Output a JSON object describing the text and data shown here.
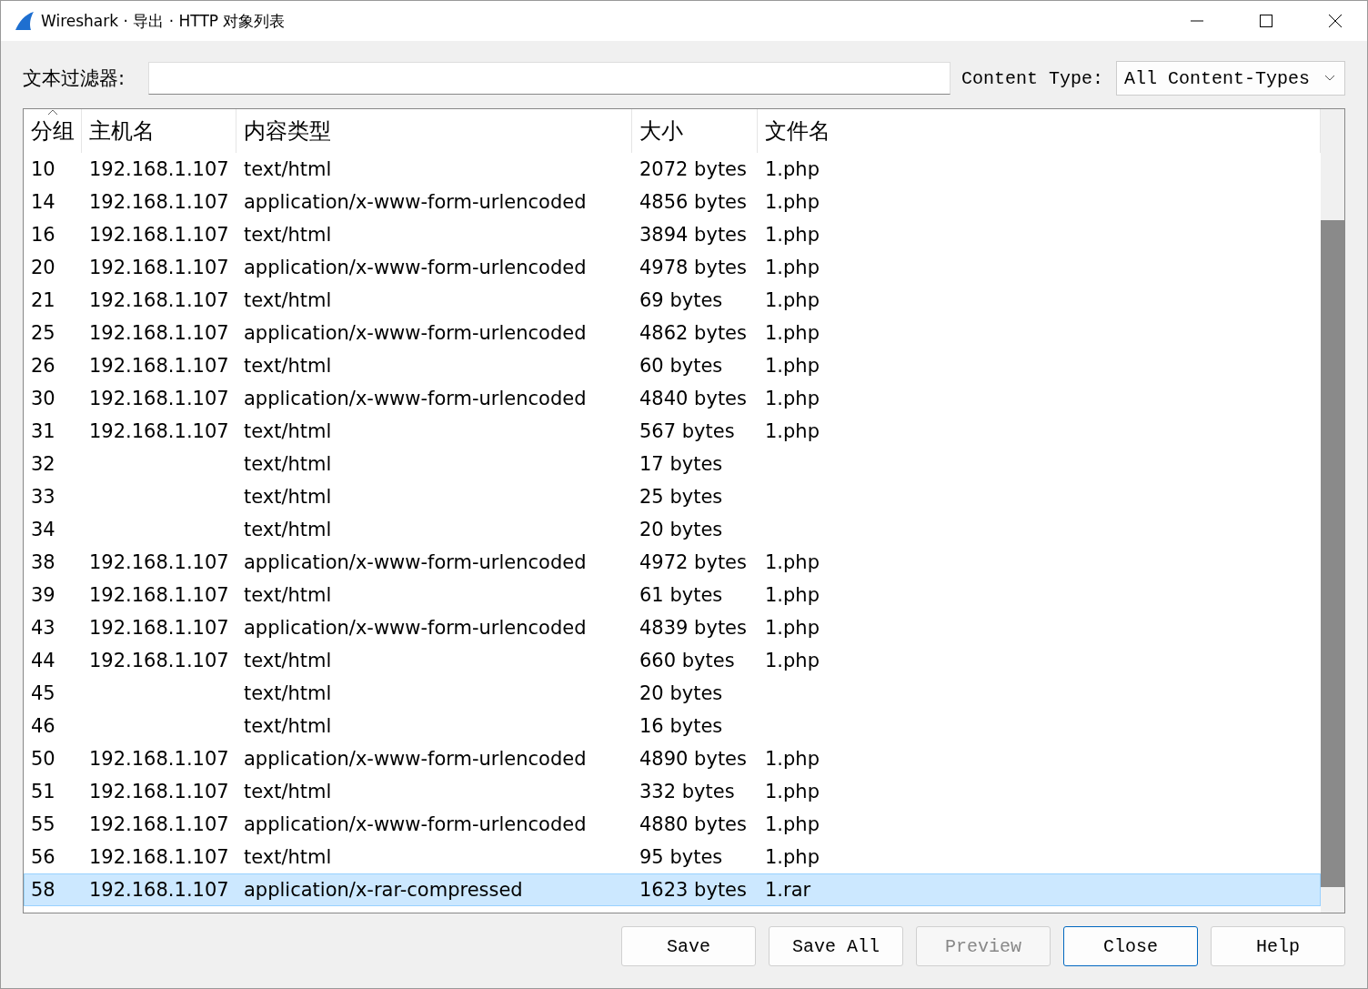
{
  "window": {
    "title": "Wireshark · 导出 · HTTP 对象列表"
  },
  "filter": {
    "label": "文本过滤器:"
  },
  "content_type": {
    "label": "Content Type:",
    "value": "All Content-Types"
  },
  "table": {
    "columns": [
      {
        "label": "分组",
        "sorted": true
      },
      {
        "label": "主机名",
        "sorted": false
      },
      {
        "label": "内容类型",
        "sorted": false
      },
      {
        "label": "大小",
        "sorted": false
      },
      {
        "label": "文件名",
        "sorted": false
      }
    ],
    "rows": [
      {
        "packet": "10",
        "host": "192.168.1.107",
        "type": "text/html",
        "size": "2072 bytes",
        "file": "1.php",
        "selected": false
      },
      {
        "packet": "14",
        "host": "192.168.1.107",
        "type": "application/x-www-form-urlencoded",
        "size": "4856 bytes",
        "file": "1.php",
        "selected": false
      },
      {
        "packet": "16",
        "host": "192.168.1.107",
        "type": "text/html",
        "size": "3894 bytes",
        "file": "1.php",
        "selected": false
      },
      {
        "packet": "20",
        "host": "192.168.1.107",
        "type": "application/x-www-form-urlencoded",
        "size": "4978 bytes",
        "file": "1.php",
        "selected": false
      },
      {
        "packet": "21",
        "host": "192.168.1.107",
        "type": "text/html",
        "size": "69 bytes",
        "file": "1.php",
        "selected": false
      },
      {
        "packet": "25",
        "host": "192.168.1.107",
        "type": "application/x-www-form-urlencoded",
        "size": "4862 bytes",
        "file": "1.php",
        "selected": false
      },
      {
        "packet": "26",
        "host": "192.168.1.107",
        "type": "text/html",
        "size": "60 bytes",
        "file": "1.php",
        "selected": false
      },
      {
        "packet": "30",
        "host": "192.168.1.107",
        "type": "application/x-www-form-urlencoded",
        "size": "4840 bytes",
        "file": "1.php",
        "selected": false
      },
      {
        "packet": "31",
        "host": "192.168.1.107",
        "type": "text/html",
        "size": "567 bytes",
        "file": "1.php",
        "selected": false
      },
      {
        "packet": "32",
        "type": "text/html",
        "size": "17 bytes",
        "selected": false
      },
      {
        "packet": "33",
        "type": "text/html",
        "size": "25 bytes",
        "selected": false
      },
      {
        "packet": "34",
        "type": "text/html",
        "size": "20 bytes",
        "selected": false
      },
      {
        "packet": "38",
        "host": "192.168.1.107",
        "type": "application/x-www-form-urlencoded",
        "size": "4972 bytes",
        "file": "1.php",
        "selected": false
      },
      {
        "packet": "39",
        "host": "192.168.1.107",
        "type": "text/html",
        "size": "61 bytes",
        "file": "1.php",
        "selected": false
      },
      {
        "packet": "43",
        "host": "192.168.1.107",
        "type": "application/x-www-form-urlencoded",
        "size": "4839 bytes",
        "file": "1.php",
        "selected": false
      },
      {
        "packet": "44",
        "host": "192.168.1.107",
        "type": "text/html",
        "size": "660 bytes",
        "file": "1.php",
        "selected": false
      },
      {
        "packet": "45",
        "type": "text/html",
        "size": "20 bytes",
        "selected": false
      },
      {
        "packet": "46",
        "type": "text/html",
        "size": "16 bytes",
        "selected": false
      },
      {
        "packet": "50",
        "host": "192.168.1.107",
        "type": "application/x-www-form-urlencoded",
        "size": "4890 bytes",
        "file": "1.php",
        "selected": false
      },
      {
        "packet": "51",
        "host": "192.168.1.107",
        "type": "text/html",
        "size": "332 bytes",
        "file": "1.php",
        "selected": false
      },
      {
        "packet": "55",
        "host": "192.168.1.107",
        "type": "application/x-www-form-urlencoded",
        "size": "4880 bytes",
        "file": "1.php",
        "selected": false
      },
      {
        "packet": "56",
        "host": "192.168.1.107",
        "type": "text/html",
        "size": "95 bytes",
        "file": "1.php",
        "selected": false
      },
      {
        "packet": "58",
        "host": "192.168.1.107",
        "type": "application/x-rar-compressed",
        "size": "1623 bytes",
        "file": "1.rar",
        "selected": true
      }
    ]
  },
  "buttons": [
    {
      "label": "Save",
      "disabled": false,
      "focused": false
    },
    {
      "label": "Save All",
      "disabled": false,
      "focused": false
    },
    {
      "label": "Preview",
      "disabled": true,
      "focused": false
    },
    {
      "label": "Close",
      "disabled": false,
      "focused": true
    },
    {
      "label": "Help",
      "disabled": false,
      "focused": false
    }
  ]
}
